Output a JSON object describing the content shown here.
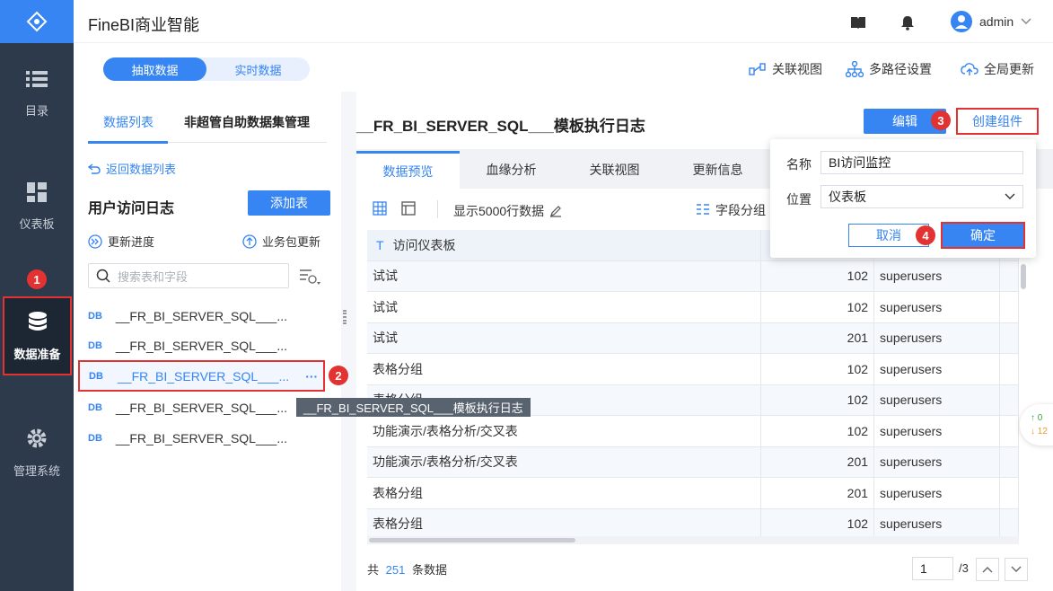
{
  "app": {
    "title": "FineBI商业智能",
    "user": "admin"
  },
  "nav": [
    {
      "label": "目录",
      "icon": "list-icon"
    },
    {
      "label": "仪表板",
      "icon": "dashboard-icon"
    },
    {
      "label": "数据准备",
      "icon": "database-icon"
    },
    {
      "label": "管理系统",
      "icon": "gear-icon"
    }
  ],
  "topbar": {
    "mode_extract": "抽取数据",
    "mode_realtime": "实时数据",
    "relation_view": "关联视图",
    "multipath": "多路径设置",
    "global_update": "全局更新"
  },
  "left": {
    "tab_list": "数据列表",
    "tab_manage": "非超管自助数据集管理",
    "back": "返回数据列表",
    "group": "用户访问日志",
    "add_table": "添加表",
    "update_progress": "更新进度",
    "package_update": "业务包更新",
    "search_placeholder": "搜索表和字段",
    "items": [
      "__FR_BI_SERVER_SQL___...",
      "__FR_BI_SERVER_SQL___...",
      "__FR_BI_SERVER_SQL___...",
      "__FR_BI_SERVER_SQL___...",
      "__FR_BI_SERVER_SQL___..."
    ],
    "item_db": "DB",
    "more": "···",
    "tooltip": "__FR_BI_SERVER_SQL___模板执行日志"
  },
  "main": {
    "title": "__FR_BI_SERVER_SQL___模板执行日志",
    "edit": "编辑",
    "create_component": "创建组件",
    "tabs": [
      "数据预览",
      "血缘分析",
      "关联视图",
      "更新信息"
    ],
    "show_rows": "显示5000行数据",
    "field_group": "字段分组",
    "column_header": "访问仪表板",
    "rows": [
      [
        "试试",
        "102",
        "superusers"
      ],
      [
        "试试",
        "102",
        "superusers"
      ],
      [
        "试试",
        "201",
        "superusers"
      ],
      [
        "表格分组",
        "102",
        "superusers"
      ],
      [
        "表格分组",
        "102",
        "superusers"
      ],
      [
        "功能演示/表格分析/交叉表",
        "102",
        "superusers"
      ],
      [
        "功能演示/表格分析/交叉表",
        "201",
        "superusers"
      ],
      [
        "表格分组",
        "201",
        "superusers"
      ],
      [
        "表格分组",
        "102",
        "superusers"
      ]
    ],
    "footer_prefix": "共",
    "footer_count": "251",
    "footer_suffix": "条数据",
    "page_current": "1",
    "page_total": "/3"
  },
  "popup": {
    "name_label": "名称",
    "name_value": "BI访问监控",
    "position_label": "位置",
    "position_value": "仪表板",
    "cancel": "取消",
    "confirm": "确定"
  },
  "float": {
    "up": "↑ 0",
    "down": "↓ 12"
  },
  "annotations": [
    "1",
    "2",
    "3",
    "4"
  ],
  "colors": {
    "accent": "#3685f2",
    "nav_bg": "#2d3a4b",
    "highlight": "#e23232"
  }
}
